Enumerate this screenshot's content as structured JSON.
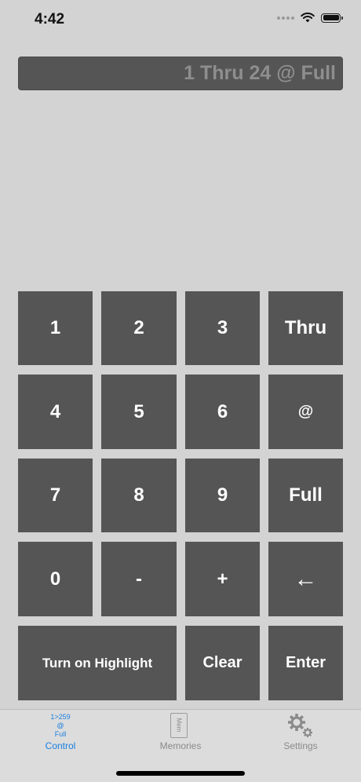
{
  "status_bar": {
    "time": "4:42"
  },
  "display": {
    "command_text": "1 Thru 24 @ Full"
  },
  "keypad": {
    "key_1": "1",
    "key_2": "2",
    "key_3": "3",
    "key_thru": "Thru",
    "key_4": "4",
    "key_5": "5",
    "key_6": "6",
    "key_at": "@",
    "key_7": "7",
    "key_8": "8",
    "key_9": "9",
    "key_full": "Full",
    "key_0": "0",
    "key_minus": "-",
    "key_plus": "+",
    "key_backspace": "←",
    "key_highlight": "Turn on Highlight",
    "key_clear": "Clear",
    "key_enter": "Enter"
  },
  "tab_bar": {
    "control_icon_line1": "1>259",
    "control_icon_line2": "@",
    "control_icon_line3": "Full",
    "memories_icon_text": "Mem",
    "tabs": [
      {
        "label": "Control",
        "active": true,
        "icon": "control-icon"
      },
      {
        "label": "Memories",
        "active": false,
        "icon": "memory-card-icon"
      },
      {
        "label": "Settings",
        "active": false,
        "icon": "gear-icon"
      }
    ]
  },
  "colors": {
    "background": "#d3d3d3",
    "key": "#555555",
    "display_text": "#8e8e8e",
    "active_tab": "#1a7fe0",
    "inactive_tab": "#8a8a8a"
  }
}
